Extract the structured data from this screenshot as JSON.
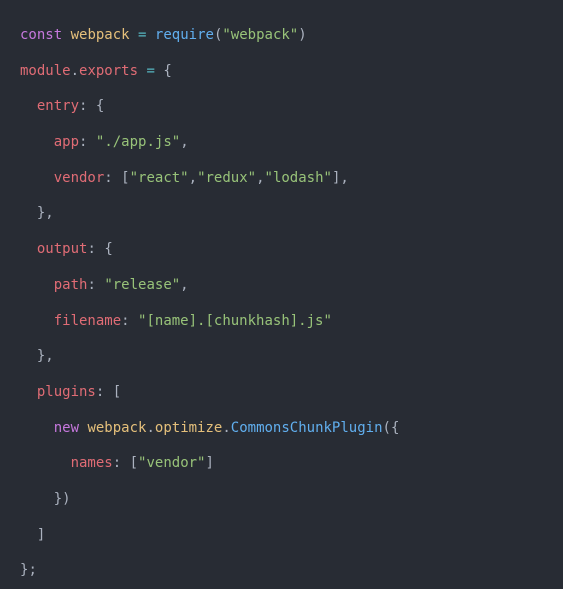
{
  "code": {
    "l1": {
      "kw_const": "const",
      "var_webpack": "webpack",
      "op_eq": "=",
      "fn_require": "require",
      "p_open": "(",
      "str_webpack": "\"webpack\"",
      "p_close": ")"
    },
    "l2": {
      "var_module": "module",
      "dot": ".",
      "prop_exports": "exports",
      "op_eq": "=",
      "brace": "{"
    },
    "l3": {
      "prop_entry": "entry",
      "colon": ":",
      "brace": "{"
    },
    "l4": {
      "prop_app": "app",
      "colon": ":",
      "str_app": "\"./app.js\"",
      "comma": ","
    },
    "l5": {
      "prop_vendor": "vendor",
      "colon": ":",
      "br_open": "[",
      "str_react": "\"react\"",
      "c1": ",",
      "str_redux": "\"redux\"",
      "c2": ",",
      "str_lodash": "\"lodash\"",
      "br_close": "]",
      "comma": ","
    },
    "l6": {
      "brace_close": "}",
      "comma": ","
    },
    "l7": {
      "prop_output": "output",
      "colon": ":",
      "brace": "{"
    },
    "l8": {
      "prop_path": "path",
      "colon": ":",
      "str_release": "\"release\"",
      "comma": ","
    },
    "l9": {
      "prop_filename": "filename",
      "colon": ":",
      "str_pattern": "\"[name].[chunkhash].js\""
    },
    "l10": {
      "brace_close": "}",
      "comma": ","
    },
    "l11": {
      "prop_plugins": "plugins",
      "colon": ":",
      "br_open": "["
    },
    "l12": {
      "kw_new": "new",
      "obj_webpack": "webpack",
      "d1": ".",
      "obj_optimize": "optimize",
      "d2": ".",
      "fn_ccp": "CommonsChunkPlugin",
      "p_open": "(",
      "brace": "{"
    },
    "l13": {
      "prop_names": "names",
      "colon": ":",
      "br_open": "[",
      "str_vendor": "\"vendor\"",
      "br_close": "]"
    },
    "l14": {
      "brace_close": "}",
      "p_close": ")"
    },
    "l15": {
      "br_close": "]"
    },
    "l16": {
      "brace_close": "}",
      "semi": ";"
    }
  }
}
